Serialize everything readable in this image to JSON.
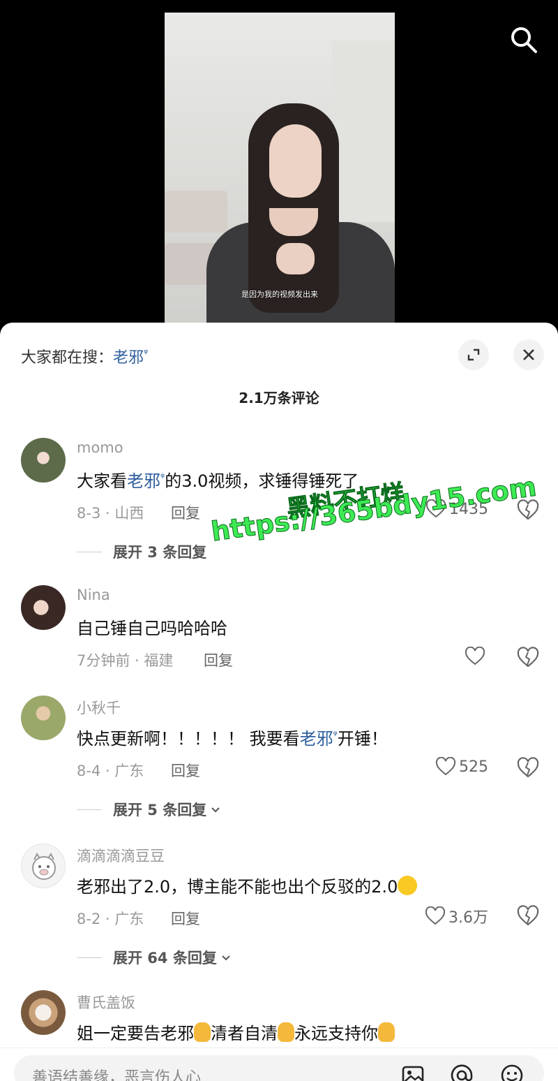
{
  "video": {
    "subtitle": "是因为我的视频发出来"
  },
  "panel": {
    "trending_prefix": "大家都在搜：",
    "trending_keyword": "老邪",
    "comment_count": "2.1万条评论"
  },
  "comments": [
    {
      "username": "momo",
      "text_before": "大家看",
      "keyword": "老邪",
      "text_after": "的3.0视频，求锤得锤",
      "text_tail": "死了",
      "meta": "8-3 · 山西",
      "reply_label": "回复",
      "likes": "1435",
      "expand_label": "展开 3 条回复"
    },
    {
      "username": "Nina",
      "text": "自己锤自己吗哈哈哈",
      "meta": "7分钟前 · 福建",
      "reply_label": "回复",
      "likes": ""
    },
    {
      "username": "小秋千",
      "text_before": "快点更新啊！！！！！ 我要看",
      "keyword": "老邪",
      "text_after": "开锤！",
      "meta": "8-4 · 广东",
      "reply_label": "回复",
      "likes": "525",
      "expand_label": "展开 5 条回复"
    },
    {
      "username": "滴滴滴滴豆豆",
      "text": "老邪出了2.0，博主能不能也出个反驳的2.0",
      "meta": "8-2 · 广东",
      "reply_label": "回复",
      "likes": "3.6万",
      "expand_label": "展开 64 条回复"
    },
    {
      "username": "曹氏盖饭",
      "seg1": "姐一定要告老邪",
      "seg2": "清者自清",
      "seg3": "永远支持你"
    }
  ],
  "watermark": {
    "line1": "黑料不打烊",
    "line2": "https://365bdy15.com"
  },
  "input": {
    "placeholder": "善语结善缘，恶言伤人心"
  }
}
